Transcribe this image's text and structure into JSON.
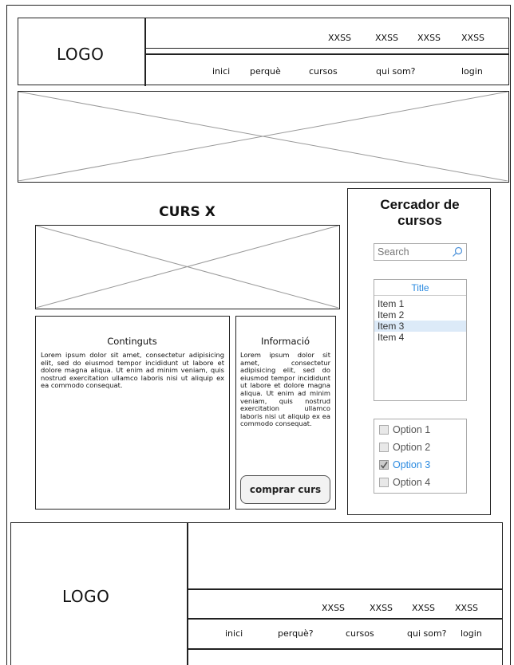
{
  "header": {
    "logo": "LOGO",
    "small_links": [
      "XXSS",
      "XXSS",
      "XXSS",
      "XXSS"
    ],
    "nav": [
      "inici",
      "perquè",
      "cursos",
      "qui som?",
      "login"
    ]
  },
  "main": {
    "course_title": "CURS X",
    "contents_title": "Continguts",
    "contents_text": "Lorem ipsum dolor sit amet, consectetur adipisicing elit, sed do eiusmod tempor incididunt ut labore et dolore magna aliqua. Ut enim ad minim veniam, quis nostrud exercitation ullamco laboris nisi ut aliquip ex ea commodo consequat.",
    "info_title": "Informació",
    "info_text": "Lorem ipsum dolor sit amet, consectetur adipisicing elit, sed do eiusmod tempor incididunt ut labore et dolore magna aliqua. Ut enim ad minim veniam, quis nostrud exercitation ullamco laboris nisi ut aliquip ex ea commodo consequat.",
    "buy_button": "comprar curs"
  },
  "sidebar": {
    "title": "Cercador de cursos",
    "search_placeholder": "Search",
    "list_title": "Title",
    "list_items": [
      "Item 1",
      "Item 2",
      "Item 3",
      "Item 4"
    ],
    "selected_item_index": 2,
    "options": [
      "Option 1",
      "Option 2",
      "Option 3",
      "Option 4"
    ],
    "checked_option_index": 2,
    "accent_color": "#2a8ae0"
  },
  "footer": {
    "logo": "LOGO",
    "small_links": [
      "XXSS",
      "XXSS",
      "XXSS",
      "XXSS"
    ],
    "nav": [
      "inici",
      "perquè?",
      "cursos",
      "qui som?",
      "login"
    ]
  }
}
